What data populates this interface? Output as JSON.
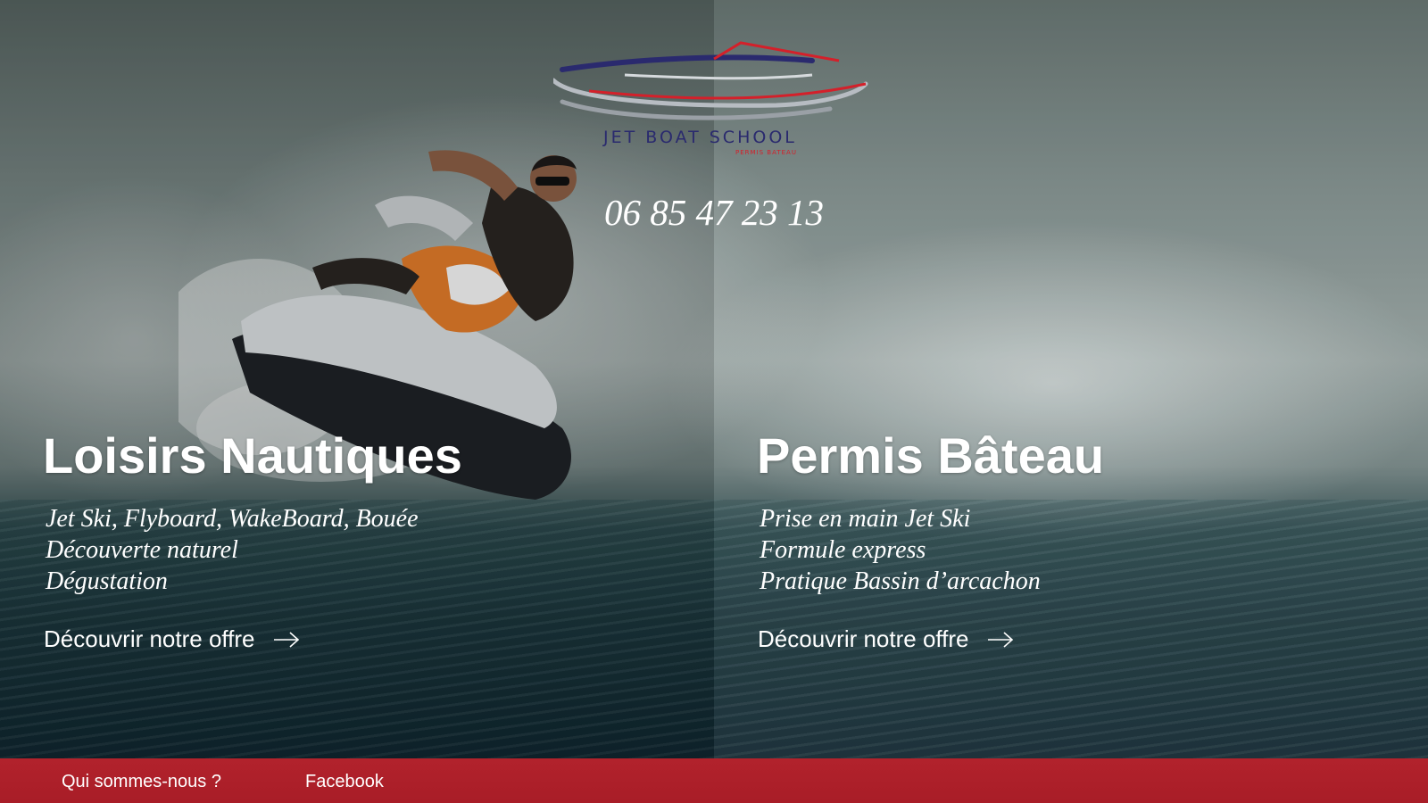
{
  "brand": {
    "name": "JET BOAT SCHOOL",
    "tagline": "PERMIS BATEAU",
    "phone": "06 85 47 23 13",
    "colors": {
      "navy": "#2a2a6e",
      "red": "#d4202a",
      "footer": "#b2222c"
    }
  },
  "sections": [
    {
      "title": "Loisirs Nautiques",
      "features": [
        "Jet Ski, Flyboard, WakeBoard, Bouée",
        "Découverte naturel",
        "Dégustation"
      ],
      "cta": "Découvrir notre offre",
      "cta_icon": "arrow-right-icon"
    },
    {
      "title": "Permis Bâteau",
      "features": [
        "Prise en main Jet Ski",
        "Formule express",
        "Pratique Bassin d’arcachon"
      ],
      "cta": "Découvrir notre offre",
      "cta_icon": "arrow-right-icon"
    }
  ],
  "footer": {
    "links": [
      "Qui sommes-nous ?",
      "Facebook"
    ]
  }
}
